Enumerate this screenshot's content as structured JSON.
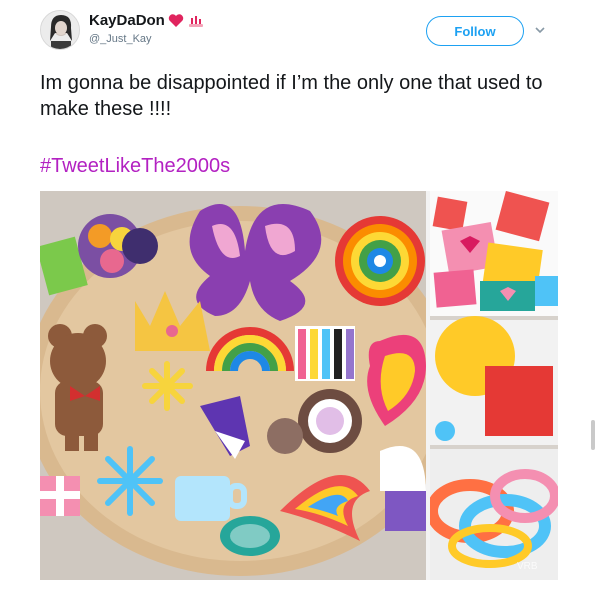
{
  "user": {
    "display_name": "KayDaDon",
    "handle": "@_Just_Kay",
    "emoji": [
      "heart",
      "nail-polish"
    ]
  },
  "actions": {
    "follow_label": "Follow"
  },
  "tweet": {
    "text": "Im gonna be disappointed if I’m the only one that used to make these !!!!",
    "hashtag": "#TweetLikeThe2000s"
  },
  "media": {
    "description_tags": [
      "perler-beads-main",
      "perler-hearts",
      "perler-pegboard",
      "perler-bracelets"
    ],
    "watermark": "VRB"
  },
  "colors": {
    "link_blue": "#1da1f2",
    "hashtag_purple": "#b321c2",
    "text": "#14171a",
    "secondary": "#657786"
  }
}
